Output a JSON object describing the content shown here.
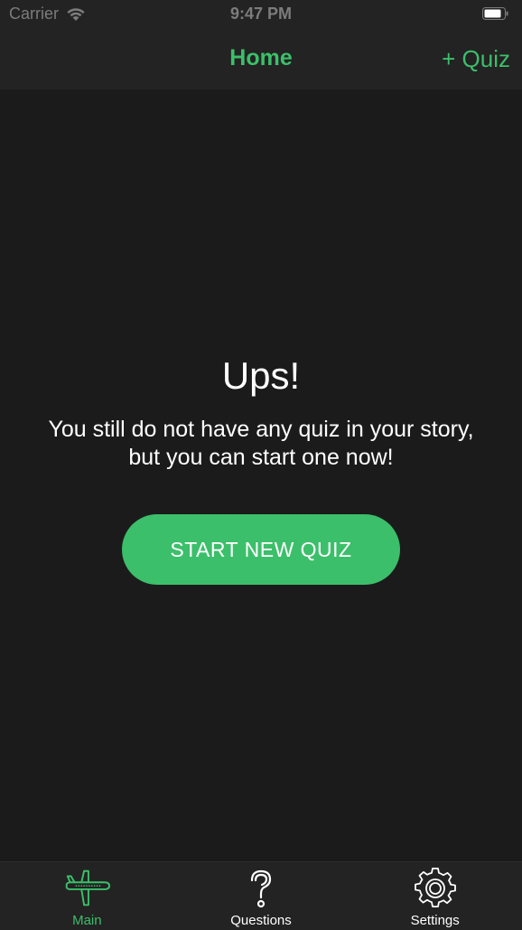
{
  "status_bar": {
    "carrier": "Carrier",
    "time": "9:47 PM",
    "icons": [
      "wifi-icon",
      "battery-icon"
    ]
  },
  "nav_bar": {
    "title": "Home",
    "action_label": "+ Quiz"
  },
  "empty_state": {
    "title": "Ups!",
    "message": "You still do not have any quiz in your story, but you can start one now!",
    "button_label": "START NEW QUIZ"
  },
  "tab_bar": {
    "items": [
      {
        "label": "Main",
        "icon": "airplane-icon",
        "active": true
      },
      {
        "label": "Questions",
        "icon": "question-mark-icon",
        "active": false
      },
      {
        "label": "Settings",
        "icon": "gear-icon",
        "active": false
      }
    ]
  },
  "colors": {
    "accent": "#3cbf6a",
    "background": "#1c1b1c",
    "bar_background": "#232323",
    "status_text": "#7c7c7c",
    "text": "#ffffff"
  }
}
